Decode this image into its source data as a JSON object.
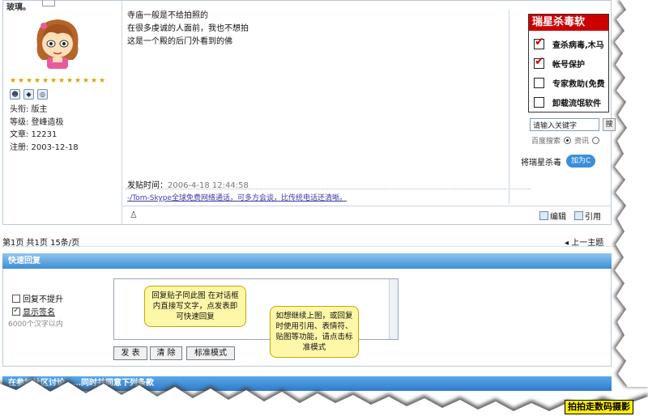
{
  "post": {
    "header_tag": "玻璃。",
    "author": {
      "avatar_icon": "cartoon-girl-avatar",
      "star_count": 12,
      "title_line": "头衔: 版主",
      "level_line": "等级: 登峰造极",
      "posts_line": "文章: 12231",
      "registered_line": "注册: 2003-12-18"
    },
    "body_lines": [
      "寺庙一般是不给拍照的",
      "在很多虔诚的人面前，我也不想拍",
      "这是一个殿的后门外看到的佛"
    ],
    "time_label": "发贴时间：",
    "time_value": "2006-4-18 12:44:58",
    "signature": "-/Tom-Skype全球免费网络通话，可多方会谈，比传统电话还清晰。",
    "edit_label": "编辑",
    "quote_label": "引用"
  },
  "ad": {
    "title": "瑞星杀毒软",
    "items": [
      {
        "label": "查杀病毒,木马",
        "checked": true
      },
      {
        "label": "帐号保护",
        "checked": true
      },
      {
        "label": "专家救助(免费",
        "checked": false
      },
      {
        "label": "卸载流氓软件",
        "checked": false
      }
    ],
    "search_placeholder": "请输入关键字",
    "search_button": "搜",
    "engine_label": "百度搜索",
    "radio_option": "资讯",
    "bottom_label": "将瑞星杀毒",
    "join_label": "加为C"
  },
  "pager": {
    "text": "第1页  共1页  15条/页",
    "next_topic": "上一主题"
  },
  "quick_reply": {
    "header": "快速回复",
    "no_bump_label": "回复不提升",
    "show_sig_label": "显示签名",
    "show_sig_checked": true,
    "char_limit": "6000个汉字以内",
    "bubble1": "回复贴子同此图 在对话框内直接写文字，点发表即可快速回复",
    "bubble2": "如想继续上图，或回复时使用引用、表情符、贴图等功能，请点击标准模式",
    "submit_label": "发 表",
    "clear_label": "清 除",
    "standard_label": "标准模式"
  },
  "terms": {
    "header": "在参加社区讨论……同时并同意下列条款"
  },
  "watermark": "拍拍走数码摄影",
  "colors": {
    "header_blue": "#3d8fd4",
    "ad_red": "#cc0000",
    "signature": "#3a3aa6",
    "watermark_bg": "#ffee00"
  }
}
